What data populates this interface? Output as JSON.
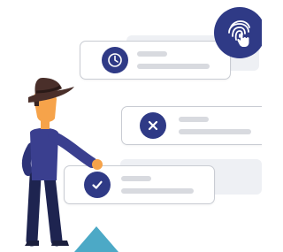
{
  "illustration": {
    "cards": [
      {
        "status": "pending",
        "icon": "clock-icon"
      },
      {
        "status": "rejected",
        "icon": "close-icon"
      },
      {
        "status": "approved",
        "icon": "check-icon"
      }
    ],
    "badge_icon": "fingerprint-touch-icon",
    "colors": {
      "primary": "#2f3a86",
      "accent": "#4ca9c6",
      "skin": "#f6a34a",
      "hat": "#4a2f2a",
      "shirt": "#3a3f8f",
      "pants": "#1e2450",
      "placeholder_line": "#d8dadf",
      "card_border": "#c9ccd3"
    }
  }
}
